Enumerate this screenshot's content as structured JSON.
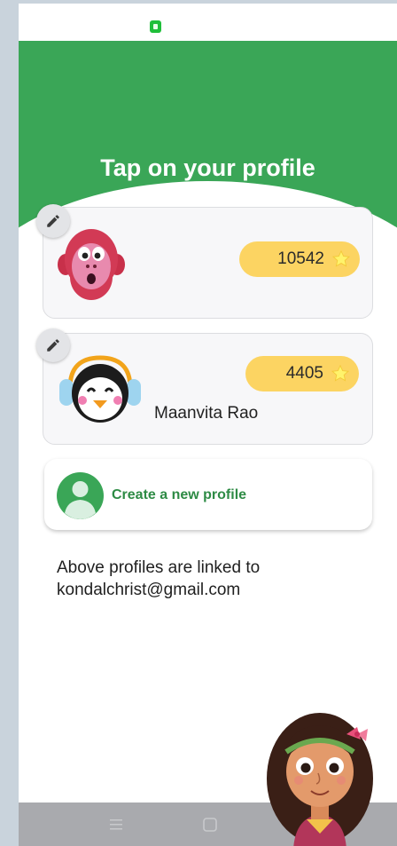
{
  "status_bar": {
    "notification_icon": "app-notification-icon"
  },
  "header": {
    "title": "Tap on your profile"
  },
  "profiles": [
    {
      "avatar": "monkey-avatar",
      "score": "10542",
      "name": "",
      "score_icon": "star-icon"
    },
    {
      "avatar": "penguin-avatar",
      "score": "4405",
      "name": "Maanvita Rao",
      "score_icon": "star-icon"
    }
  ],
  "create_profile": {
    "label": "Create a new profile",
    "icon": "person-avatar-icon"
  },
  "linked_info": {
    "text": "Above profiles are linked to kondalchrist@gmail.com"
  },
  "nav_bar": {
    "menu_icon": "menu-icon",
    "home_icon": "home-icon",
    "back_icon": "back-icon"
  },
  "colors": {
    "brand_green": "#3aa657",
    "pill_yellow": "#fcd462",
    "link_green": "#2e8b45"
  }
}
